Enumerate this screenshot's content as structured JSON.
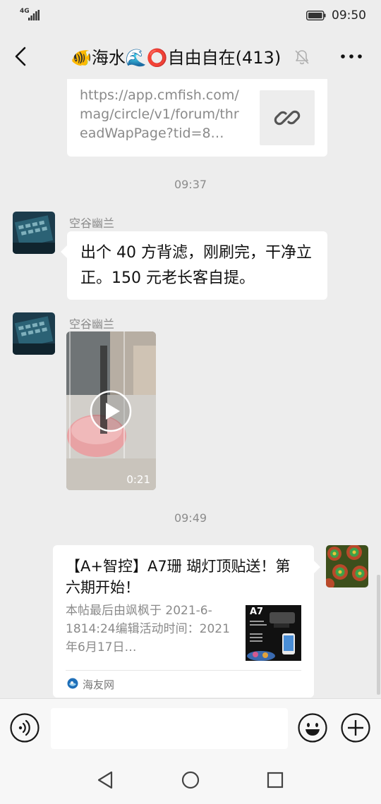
{
  "status_bar": {
    "network": "4G",
    "time": "09:50"
  },
  "header": {
    "title": "🐠海水🌊⭕自由自在(413)"
  },
  "link_card": {
    "url": "https://app.cmfish.com/mag/circle/v1/forum/threadWapPage?tid=8…"
  },
  "timestamps": [
    "09:37",
    "09:49"
  ],
  "messages": [
    {
      "sender": "空谷幽兰",
      "text": "出个 40 方背滤，刚刷完，干净立正。150 元老长客自提。"
    },
    {
      "sender": "空谷幽兰",
      "video_duration": "0:21"
    }
  ],
  "article": {
    "title": "【A+智控】A7珊 瑚灯顶贴送！第六期开始！",
    "description": "本帖最后由飒枫于 2021-6-1814:24编辑活动时间：2021年6月17日…",
    "thumb_label": "A7",
    "source": "海友网"
  },
  "input": {
    "placeholder": ""
  }
}
